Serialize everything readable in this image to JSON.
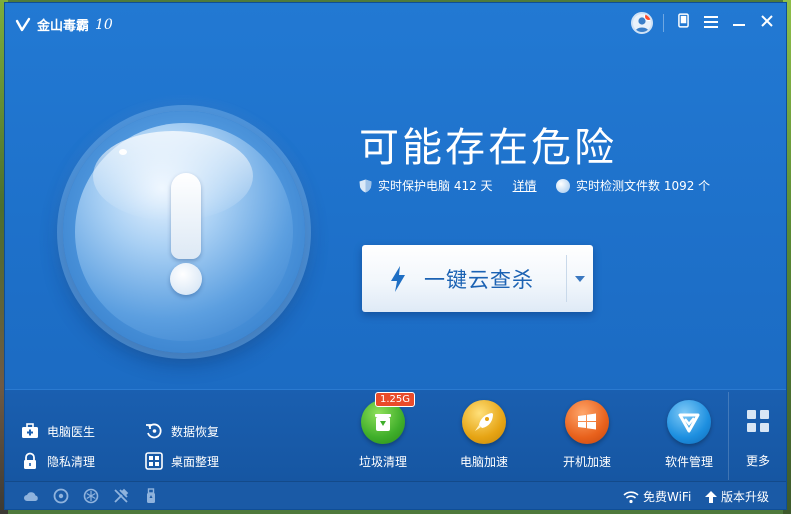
{
  "app": {
    "name": "金山毒霸",
    "version": "10"
  },
  "status": {
    "title": "可能存在危险",
    "protect_text": "实时保护电脑 412 天",
    "detail_link": "详情",
    "scan_text": "实时检测文件数 1092 个"
  },
  "scan_button": {
    "label": "一键云查杀"
  },
  "tools": {
    "doctor": "电脑医生",
    "recovery": "数据恢复",
    "privacy": "隐私清理",
    "desktop": "桌面整理"
  },
  "features": [
    {
      "label": "垃圾清理",
      "badge": "1.25G",
      "color": "#3fae2a"
    },
    {
      "label": "电脑加速",
      "color": "#e6a414"
    },
    {
      "label": "开机加速",
      "color": "#e8611c"
    },
    {
      "label": "软件管理",
      "color": "#1d8fe0"
    }
  ],
  "more_label": "更多",
  "footer": {
    "wifi": "免费WiFi",
    "upgrade": "版本升级"
  },
  "icons": [
    "logo-icon",
    "user-avatar-icon",
    "phone-icon",
    "menu-icon",
    "minimize-icon",
    "close-icon",
    "shield-icon",
    "globe-icon",
    "lightning-icon",
    "chevron-down-icon",
    "medical-kit-icon",
    "restore-icon",
    "lock-icon",
    "desktop-grid-icon",
    "recycle-icon",
    "rocket-icon",
    "windows-icon",
    "software-icon",
    "grid-icon",
    "cloud-icon",
    "disc-icon",
    "snowflake-icon",
    "tools-icon",
    "usb-icon",
    "wifi-icon",
    "upload-arrow-icon"
  ]
}
